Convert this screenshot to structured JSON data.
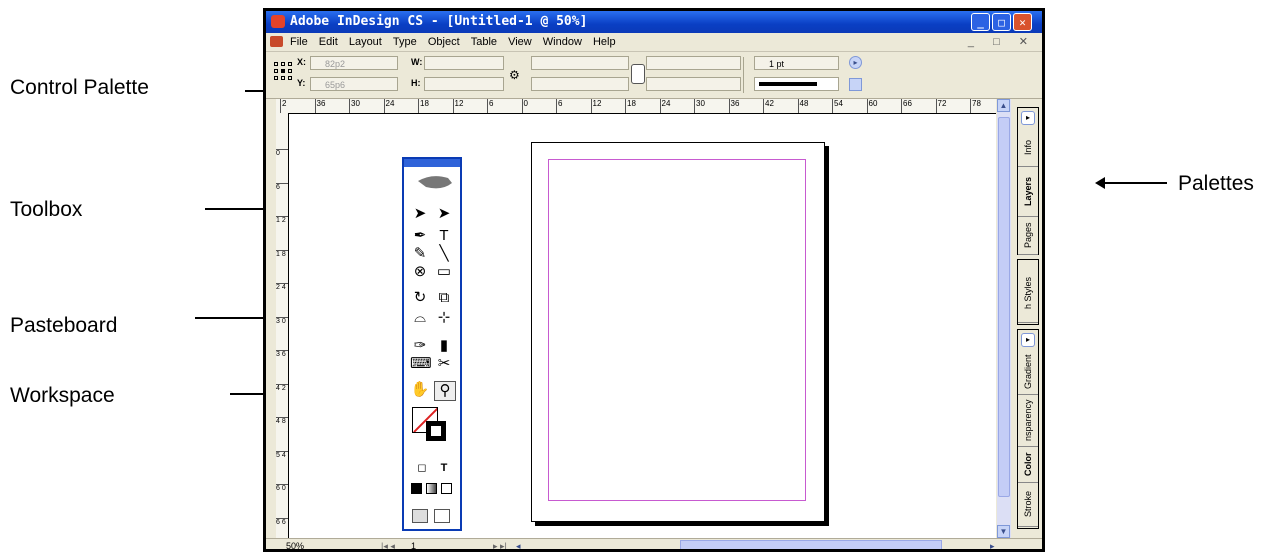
{
  "annotations": {
    "control_palette": "Control Palette",
    "toolbox": "Toolbox",
    "pasteboard": "Pasteboard",
    "workspace": "Workspace",
    "palettes": "Palettes"
  },
  "window": {
    "title": "Adobe InDesign CS - [Untitled-1 @ 50%]",
    "buttons": {
      "minimize": "_",
      "maximize": "□",
      "close": "✕"
    },
    "mdi_controls": "_ □ ✕"
  },
  "menu": [
    "File",
    "Edit",
    "Layout",
    "Type",
    "Object",
    "Table",
    "View",
    "Window",
    "Help"
  ],
  "control_palette": {
    "x_label": "X:",
    "x_value": "82p2",
    "y_label": "Y:",
    "y_value": "65p6",
    "w_label": "W:",
    "h_label": "H:",
    "stroke_weight": "1 pt"
  },
  "ruler_h_labels": [
    "2",
    "36",
    "30",
    "24",
    "18",
    "12",
    "6",
    "0",
    "6",
    "12",
    "18",
    "24",
    "30",
    "36",
    "42",
    "48",
    "54",
    "60",
    "66",
    "72",
    "78"
  ],
  "ruler_v_labels": [
    "0",
    "6",
    "1 2",
    "1 8",
    "2 4",
    "3 0",
    "3 6",
    "4 2",
    "4 8",
    "5 4",
    "6 0",
    "6 6"
  ],
  "statusbar": {
    "zoom": "50%",
    "page": "1"
  },
  "palette_tabs": {
    "group1": [
      "Pages",
      "Layers",
      "Info"
    ],
    "group2": [
      "h Styles"
    ],
    "group3": [
      "Stroke",
      "Color",
      "nsparency",
      "Gradient"
    ]
  },
  "toolbox": {
    "tools": [
      "selection-tool",
      "direct-selection-tool",
      "pen-tool",
      "type-tool",
      "pencil-tool",
      "line-tool",
      "frame-tool",
      "rectangle-tool",
      "rotate-tool",
      "scale-tool",
      "shear-tool",
      "free-transform-tool",
      "eyedropper-tool",
      "gradient-tool",
      "button-tool",
      "scissors-tool",
      "hand-tool",
      "zoom-tool"
    ],
    "type_label": "T"
  }
}
